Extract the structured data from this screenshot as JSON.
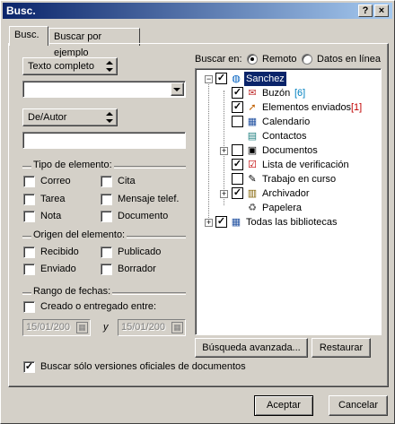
{
  "window": {
    "title": "Busc.",
    "help_label": "?",
    "close_label": "×"
  },
  "tabs": [
    {
      "label": "Busc."
    },
    {
      "label": "Buscar por ejemplo"
    }
  ],
  "left": {
    "field_dropdown": {
      "value": "Texto completo"
    },
    "text_input": {
      "value": ""
    },
    "author_dropdown": {
      "value": "De/Autor"
    },
    "author_input": {
      "value": ""
    },
    "element_type": {
      "title": "Tipo de elemento:",
      "items": [
        "Correo",
        "Cita",
        "Tarea",
        "Mensaje telef.",
        "Nota",
        "Documento"
      ]
    },
    "element_origin": {
      "title": "Origen del elemento:",
      "items": [
        "Recibido",
        "Publicado",
        "Enviado",
        "Borrador"
      ]
    },
    "date_range": {
      "title": "Rango de fechas:",
      "created_label": "Creado o entregado entre:",
      "from_date": "15/01/200",
      "and_label": "y",
      "to_date": "15/01/200"
    }
  },
  "right": {
    "search_in_label": "Buscar en:",
    "radio_remote": "Remoto",
    "radio_online": "Datos en línea",
    "tree": [
      {
        "label": "Sanchez",
        "count": "",
        "checked": true,
        "icon": "globe-icon"
      },
      {
        "label": "Buzón",
        "count": "[6]",
        "checked": true,
        "icon": "mailbox-icon"
      },
      {
        "label": "Elementos enviados",
        "count": "[1]",
        "checked": true,
        "icon": "sent-items-icon"
      },
      {
        "label": "Calendario",
        "count": "",
        "checked": false,
        "icon": "calendar-icon"
      },
      {
        "label": "Contactos",
        "count": "",
        "checked": false,
        "icon": "contacts-icon"
      },
      {
        "label": "Documentos",
        "count": "",
        "checked": false,
        "icon": "documents-icon"
      },
      {
        "label": "Lista de verificación",
        "count": "",
        "checked": true,
        "icon": "checklist-icon"
      },
      {
        "label": "Trabajo en curso",
        "count": "",
        "checked": false,
        "icon": "work-in-progress-icon"
      },
      {
        "label": "Archivador",
        "count": "",
        "checked": true,
        "icon": "cabinet-icon"
      },
      {
        "label": "Papelera",
        "count": "",
        "checked": false,
        "icon": "trash-icon"
      },
      {
        "label": "Todas las bibliotecas",
        "count": "",
        "checked": true,
        "icon": "libraries-icon"
      }
    ],
    "advanced_button": "Búsqueda avanzada...",
    "restore_button": "Restaurar"
  },
  "official_versions_label": "Buscar sólo versiones oficiales de documentos",
  "footer": {
    "ok_button": "Aceptar",
    "cancel_button": "Cancelar"
  },
  "colors": {
    "title_start": "#0a246a",
    "title_end": "#a6caf0",
    "selection": "#0a246a",
    "count_blue": "#0080c0",
    "count_red": "#c00000"
  }
}
